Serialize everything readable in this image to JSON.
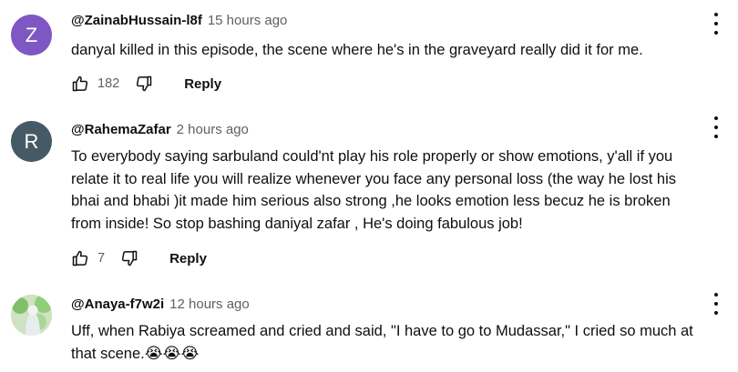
{
  "colors": {
    "avatar_z": "#7e57c2",
    "avatar_r": "#455a64",
    "meta_text": "#606060"
  },
  "comments": [
    {
      "avatar_letter": "Z",
      "handle": "@ZainabHussain-l8f",
      "time": "15 hours ago",
      "text_lines": [
        "danyal killed in this episode, the scene where he's in the graveyard really did it for me."
      ],
      "likes": "182",
      "reply_label": "Reply"
    },
    {
      "avatar_letter": "R",
      "handle": "@RahemaZafar",
      "time": "2 hours ago",
      "text_lines": [
        "To everybody saying sarbuland  could'nt play his role properly or show emotions, y'all if you",
        "relate it to real life you will realize whenever you face any personal loss (the way he lost his",
        "bhai and bhabi )it made him serious also strong ,he looks emotion less becuz he is broken",
        "from inside! So stop bashing daniyal zafar , He's doing fabulous job!"
      ],
      "likes": "7",
      "reply_label": "Reply"
    },
    {
      "avatar_letter": "",
      "handle": "@Anaya-f7w2i",
      "time": "12 hours ago",
      "text_lines": [
        "Uff, when Rabiya screamed and cried and said, \"I have to go to Mudassar,\" I cried so much at",
        "that scene."
      ],
      "emojis": "😭😭😭"
    }
  ]
}
